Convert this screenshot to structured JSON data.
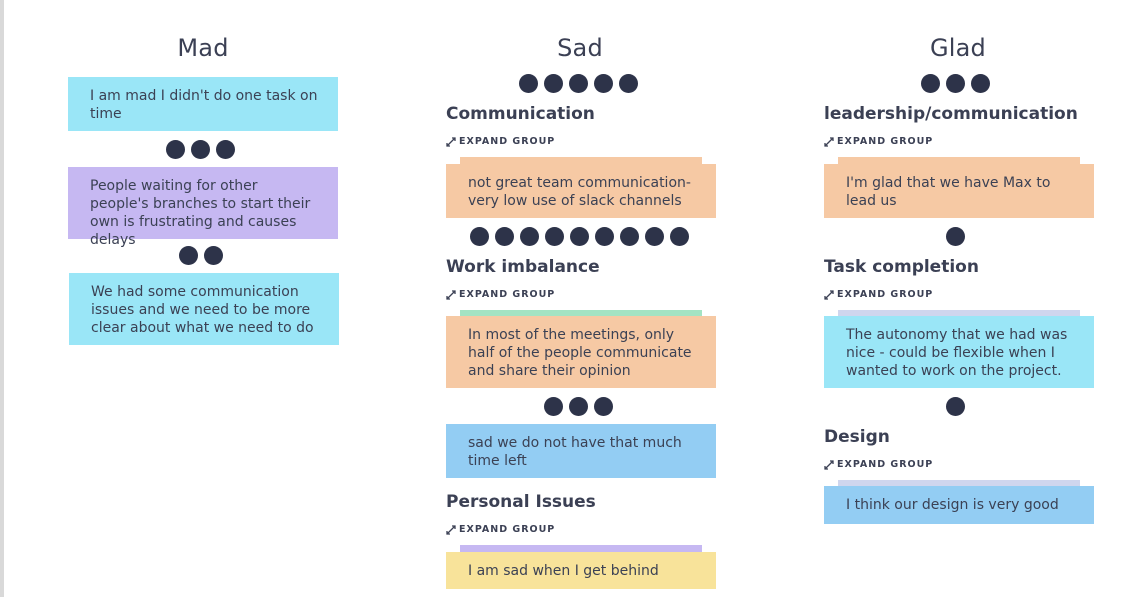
{
  "columns": [
    {
      "title": "Mad"
    },
    {
      "title": "Sad"
    },
    {
      "title": "Glad"
    }
  ],
  "expand_label": "EXPAND GROUP",
  "mad": {
    "cards": [
      {
        "text": "I am mad I didn't do one task on time"
      },
      {
        "text": "People waiting for other people's branches to start their own is frustrating and causes delays",
        "votes": 3
      },
      {
        "text": "We had some communication issues and we need to be more clear about what we need to do",
        "votes": 2
      }
    ]
  },
  "sad": {
    "groups": [
      {
        "title": "Communication",
        "votes": 5,
        "card": "not great team communication- very low use of slack channels"
      },
      {
        "title": "Work imbalance",
        "votes": 9,
        "card": "In most of the meetings, only half of the people communicate and share their opinion"
      },
      {
        "title": "Personal Issues",
        "card": "I am sad when I get behind"
      }
    ],
    "loose_card": {
      "text": "sad we do not have that much time left",
      "votes": 3
    }
  },
  "glad": {
    "groups": [
      {
        "title": "leadership/communication",
        "votes": 3,
        "card": "I'm glad that we have Max to lead us"
      },
      {
        "title": "Task completion",
        "votes": 1,
        "card": "The autonomy that we had was nice - could be flexible when I wanted to work on the project."
      },
      {
        "title": "Design",
        "votes": 1,
        "card": "I think our design is very good"
      }
    ]
  },
  "colors": {
    "cyan": "#9ae6f7",
    "purple": "#c6b8f2",
    "orange": "#f6c9a4",
    "blue": "#93cdf3",
    "yellow": "#f8e39a",
    "vote_dot": "#2d3349",
    "stack_green": "#a3e3c3",
    "stack_purple": "#c6b8f2",
    "stack_lavender": "#cfd6ee"
  }
}
